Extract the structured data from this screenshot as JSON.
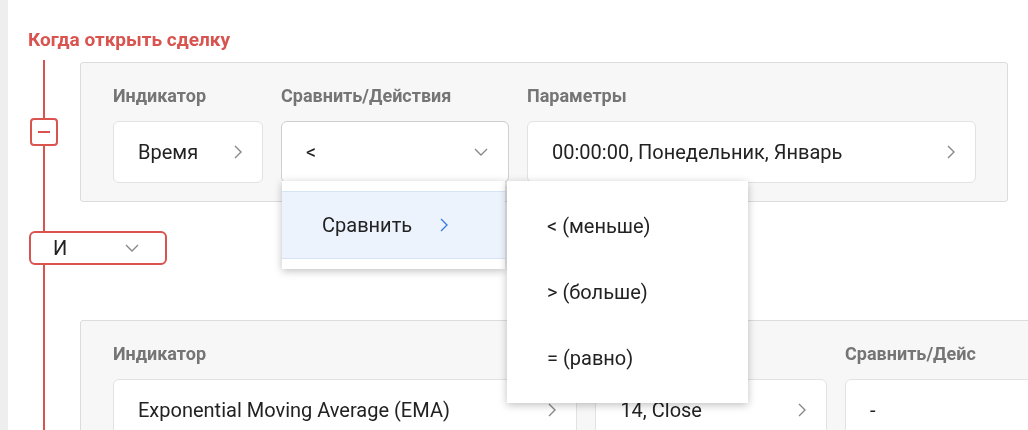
{
  "section_title": "Когда открыть сделку",
  "conditions": [
    {
      "fields": [
        {
          "label": "Индикатор",
          "value": "Время",
          "kind": "link",
          "expanded": false
        },
        {
          "label": "Сравнить/Действия",
          "value": "<",
          "kind": "select",
          "expanded": true
        },
        {
          "label": "Параметры",
          "value": "00:00:00, Понедельник, Январь",
          "kind": "link",
          "expanded": false
        }
      ]
    },
    {
      "fields": [
        {
          "label": "Индикатор",
          "value": "Exponential Moving Average (EMA)",
          "kind": "link",
          "expanded": false
        },
        {
          "value": "14, Close",
          "kind": "link",
          "expanded": false
        },
        {
          "label": "Сравнить/Дейс",
          "value": "-",
          "kind": "plain",
          "expanded": false
        }
      ]
    }
  ],
  "logic": {
    "value": "И"
  },
  "menu": {
    "items": [
      {
        "label": "Сравнить",
        "selected": true
      }
    ]
  },
  "submenu": {
    "items": [
      {
        "label": "< (меньше)",
        "selected": false
      },
      {
        "label": "> (больше)",
        "selected": false
      },
      {
        "label": "= (равно)",
        "selected": false
      }
    ]
  }
}
